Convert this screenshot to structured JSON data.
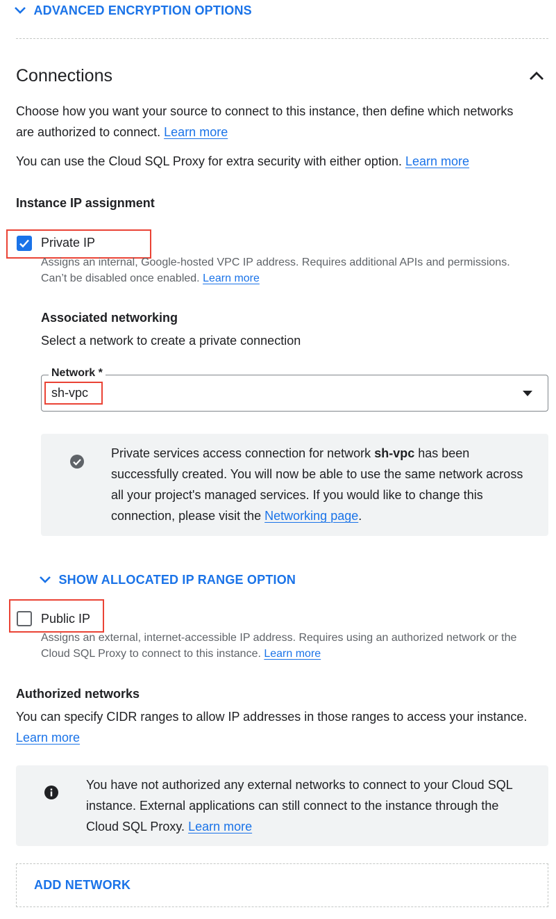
{
  "advanced_encryption": {
    "label": "ADVANCED ENCRYPTION OPTIONS"
  },
  "connections": {
    "title": "Connections",
    "desc1": "Choose how you want your source to connect to this instance, then define which networks are authorized to connect.",
    "desc2": "You can use the Cloud SQL Proxy for extra security with either option.",
    "learn_more": "Learn more"
  },
  "ip_assignment": {
    "heading": "Instance IP assignment"
  },
  "private_ip": {
    "label": "Private IP",
    "checked": true,
    "helper": "Assigns an internal, Google-hosted VPC IP address. Requires additional APIs and permissions. Can’t be disabled once enabled.",
    "learn_more": "Learn more"
  },
  "associated_networking": {
    "heading": "Associated networking",
    "desc": "Select a network to create a private connection",
    "network_label": "Network *",
    "network_value": "sh-vpc"
  },
  "psa_notice": {
    "text_before": "Private services access connection for network",
    "network_name": "sh-vpc",
    "text_after": "has been successfully created. You will now be able to use the same network across all your project's managed services. If you would like to change this connection, please visit the",
    "link": "Networking page",
    "end": "."
  },
  "allocated_range": {
    "label": "SHOW ALLOCATED IP RANGE OPTION"
  },
  "public_ip": {
    "label": "Public IP",
    "checked": false,
    "helper": "Assigns an external, internet-accessible IP address. Requires using an authorized network or the Cloud SQL Proxy to connect to this instance.",
    "learn_more": "Learn more"
  },
  "authorized_networks": {
    "heading": "Authorized networks",
    "desc": "You can specify CIDR ranges to allow IP addresses in those ranges to access your instance.",
    "learn_more": "Learn more",
    "notice": "You have not authorized any external networks to connect to your Cloud SQL instance. External applications can still connect to the instance through the Cloud SQL Proxy.",
    "notice_link": "Learn more"
  },
  "add_network": {
    "label": "ADD NETWORK"
  },
  "colors": {
    "accent": "#1a73e8",
    "highlight": "#ea4335",
    "notice_bg": "#f1f3f4"
  }
}
